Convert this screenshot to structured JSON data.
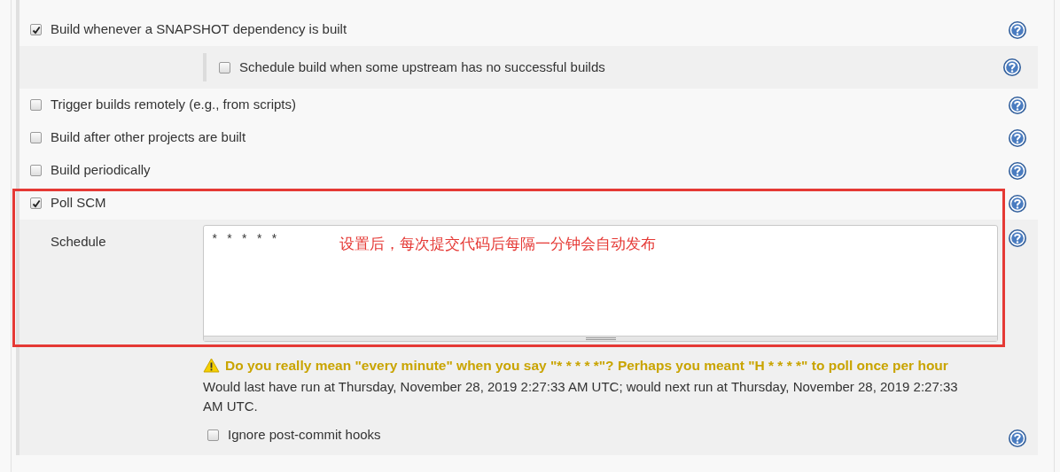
{
  "triggers": [
    {
      "label": "Build whenever a SNAPSHOT dependency is built",
      "checked": true,
      "options": [
        {
          "label": "Schedule build when some upstream has no successful builds",
          "checked": false
        }
      ]
    },
    {
      "label": "Trigger builds remotely (e.g., from scripts)",
      "checked": false
    },
    {
      "label": "Build after other projects are built",
      "checked": false
    },
    {
      "label": "Build periodically",
      "checked": false
    },
    {
      "label": "Poll SCM",
      "checked": true,
      "schedule": {
        "label": "Schedule",
        "value": "* * * * *",
        "warning": "Do you really mean \"every minute\" when you say \"* * * * *\"? Perhaps you meant \"H * * * *\" to poll once per hour",
        "info": "Would last have run at Thursday, November 28, 2019 2:27:33 AM UTC; would next run at Thursday, November 28, 2019 2:27:33 AM UTC."
      },
      "options": [
        {
          "label": "Ignore post-commit hooks",
          "checked": false
        }
      ]
    }
  ],
  "annotation": {
    "text": "设置后，每次提交代码后每隔一分钟会自动发布"
  }
}
